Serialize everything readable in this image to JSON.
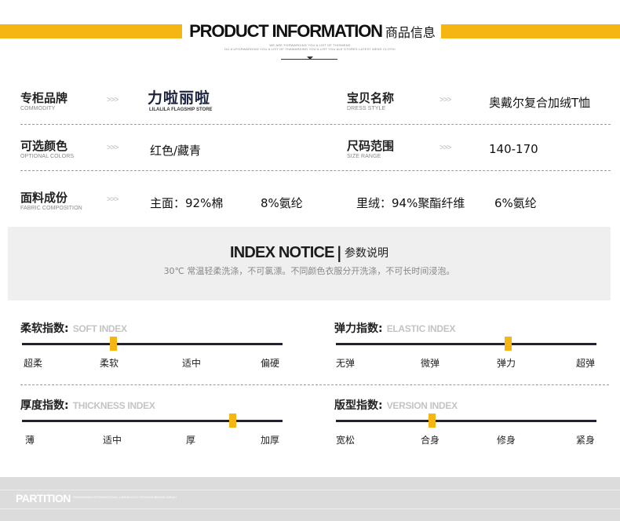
{
  "header": {
    "title_en": "PRODUCT INFORMATION",
    "title_zh": "商品信息",
    "subtitle_line1": "WE ARE FORWARDING YOU A LIST OF THISMENS",
    "subtitle_line2": "DU A UFORWARDING YOU A LIST OF THAWARDING YOU A LIST YOU ALE STORES LATEST MENS CLOTHI",
    "accent_color": "#f5b513"
  },
  "info": {
    "arrow": ">>>",
    "brand_label_zh": "专柜品牌",
    "brand_label_en": "COMMODITY",
    "brand_name_zh": "力啦丽啦",
    "brand_name_en": "LILALILA FLAGSHIP STORE",
    "dress_label_zh": "宝贝名称",
    "dress_label_en": "DRESS STYLE",
    "dress_value": "奥戴尔复合加绒T恤",
    "color_label_zh": "可选颜色",
    "color_label_en": "OPTIONAL COLORS",
    "color_value": "红色/藏青",
    "size_label_zh": "尺码范围",
    "size_label_en": "SIZE RANGE",
    "size_value": "140-170",
    "fabric_label_zh": "面料成份",
    "fabric_label_en": "FABRIC COMPOSITION",
    "fabric_v1": "主面：92%棉",
    "fabric_v2": "8%氨纶",
    "fabric_v3": "里绒：94%聚酯纤维",
    "fabric_v4": "6%氨纶"
  },
  "notice": {
    "title_en": "INDEX NOTICE",
    "divider": "|",
    "title_zh": "参数说明",
    "text": "30℃ 常温轻柔洗涤，不可氯漂。不同颜色衣服分开洗涤，不可长时间浸泡。"
  },
  "indices": {
    "soft": {
      "title_zh": "柔软指数:",
      "title_en": "SOFT INDEX",
      "ticks": [
        "超柔",
        "柔软",
        "适中",
        "偏硬"
      ],
      "level": 0.35
    },
    "elastic": {
      "title_zh": "弹力指数:",
      "title_en": "ELASTIC INDEX",
      "ticks": [
        "无弹",
        "微弹",
        "弹力",
        "超弹"
      ],
      "level": 0.66
    },
    "thickness": {
      "title_zh": "厚度指数:",
      "title_en": "THICKNESS INDEX",
      "ticks": [
        "薄",
        "适中",
        "厚",
        "加厚"
      ],
      "level": 0.81
    },
    "version": {
      "title_zh": "版型指数:",
      "title_en": "VERSION INDEX",
      "ticks": [
        "宽松",
        "合身",
        "修身",
        "紧身"
      ],
      "level": 0.37
    }
  },
  "footer": {
    "title": "PARTITION",
    "subtitle": "SUNSHINING INTERNATIONAL URBAN CHIC FASHION BRAND XIRUIC"
  }
}
